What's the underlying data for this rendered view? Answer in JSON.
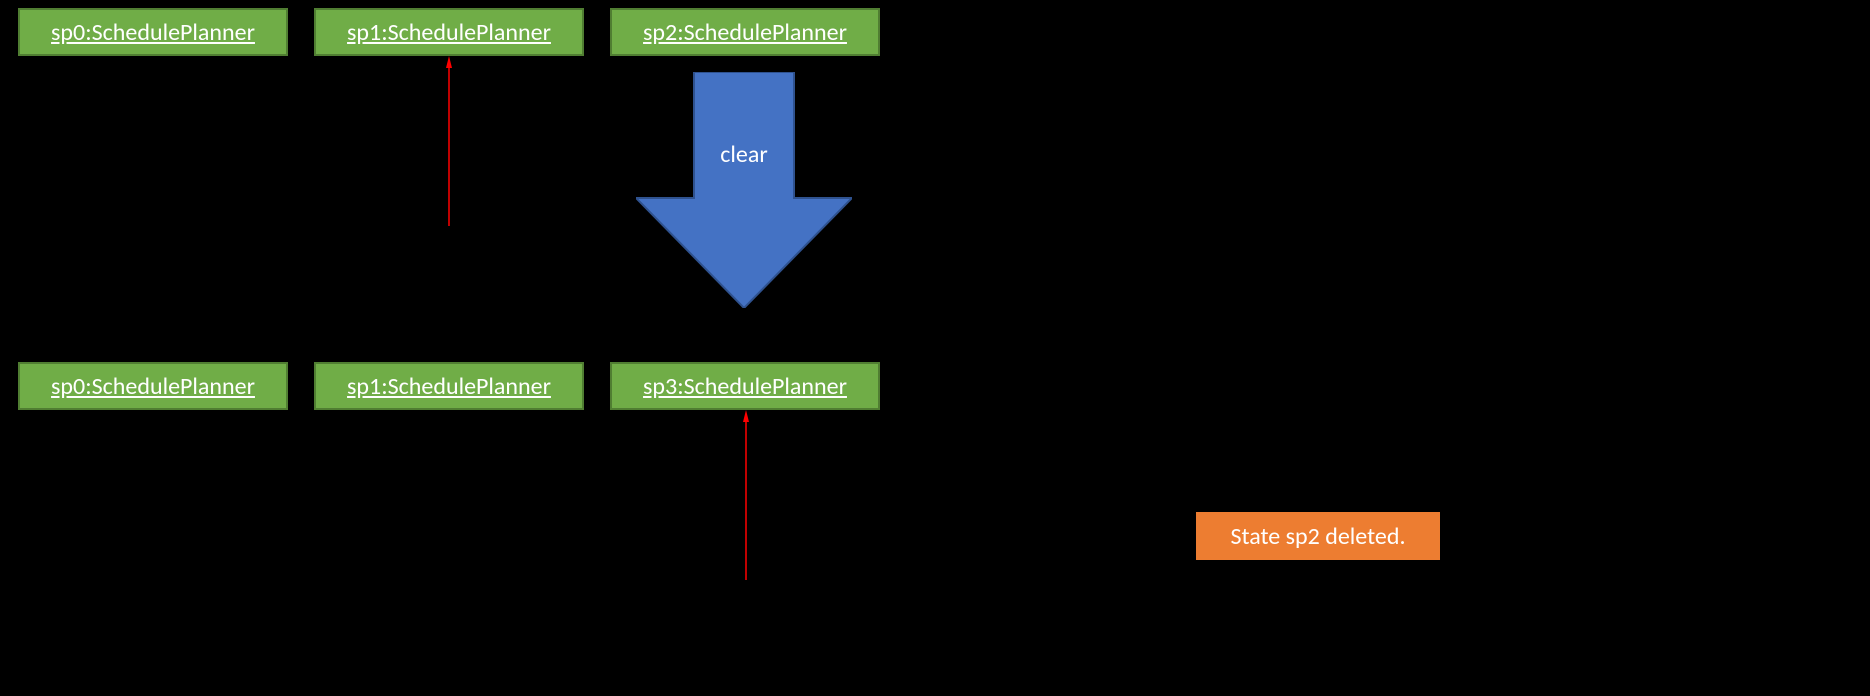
{
  "colors": {
    "node_fill": "#70ad47",
    "node_border": "#507e32",
    "big_arrow_fill": "#4472c4",
    "big_arrow_border": "#2f528f",
    "note_fill": "#ed7d31",
    "thin_arrow": "#ff0000"
  },
  "row1": {
    "sp0": "sp0:SchedulePlanner",
    "sp1": "sp1:SchedulePlanner",
    "sp2": "sp2:SchedulePlanner"
  },
  "row2": {
    "sp0": "sp0:SchedulePlanner",
    "sp1": "sp1:SchedulePlanner",
    "sp3": "sp3:SchedulePlanner"
  },
  "big_arrow_label": "clear",
  "note_text": "State sp2 deleted."
}
